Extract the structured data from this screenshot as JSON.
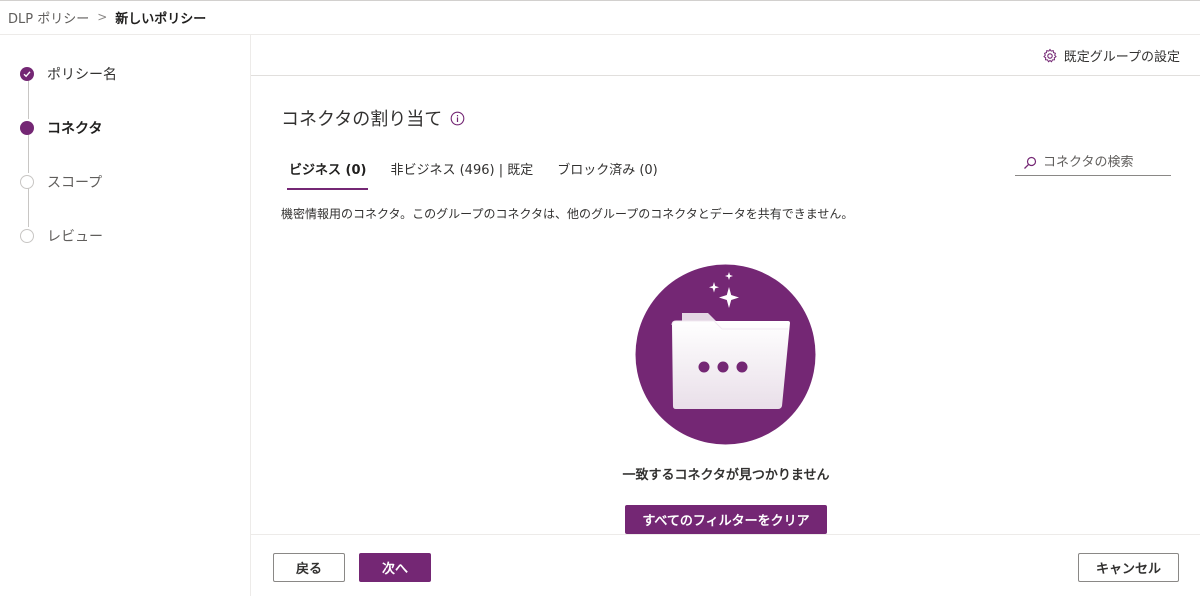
{
  "breadcrumb": {
    "parent": "DLP ポリシー",
    "separator": ">",
    "current": "新しいポリシー"
  },
  "steps": [
    {
      "label": "ポリシー名",
      "state": "done"
    },
    {
      "label": "コネクタ",
      "state": "current"
    },
    {
      "label": "スコープ",
      "state": "todo"
    },
    {
      "label": "レビュー",
      "state": "todo"
    }
  ],
  "commandbar": {
    "default_group_settings": "既定グループの設定"
  },
  "main": {
    "title": "コネクタの割り当て",
    "tabs": [
      {
        "label": "ビジネス (0)",
        "active": true
      },
      {
        "label": "非ビジネス (496) | 既定",
        "active": false
      },
      {
        "label": "ブロック済み (0)",
        "active": false
      }
    ],
    "search": {
      "placeholder": "コネクタの検索"
    },
    "description": "機密情報用のコネクタ。このグループのコネクタは、他のグループのコネクタとデータを共有できません。",
    "empty_state": {
      "message": "一致するコネクタが見つかりません",
      "clear_button": "すべてのフィルターをクリア"
    }
  },
  "footer": {
    "back": "戻る",
    "next": "次へ",
    "cancel": "キャンセル"
  },
  "colors": {
    "accent": "#742774",
    "border": "#8a8886",
    "text": "#323130"
  },
  "icons": {
    "step_done": "check-icon",
    "settings": "gear-icon",
    "info": "info-icon",
    "search": "search-icon",
    "empty": "folder-illustration"
  }
}
